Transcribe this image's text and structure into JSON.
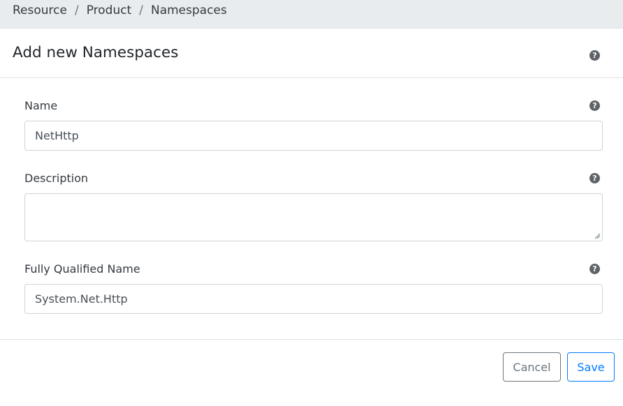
{
  "breadcrumb": {
    "items": [
      "Resource",
      "Product",
      "Namespaces"
    ],
    "separator": "/"
  },
  "card": {
    "title": "Add new Namespaces",
    "help_icon": "question-circle-icon"
  },
  "form": {
    "name": {
      "label": "Name",
      "value": "NetHttp"
    },
    "description": {
      "label": "Description",
      "value": ""
    },
    "fully_qualified_name": {
      "label": "Fully Qualified Name",
      "value": "System.Net.Http"
    }
  },
  "actions": {
    "cancel_label": "Cancel",
    "save_label": "Save"
  },
  "colors": {
    "primary": "#007bff",
    "secondary": "#6c757d",
    "breadcrumb_bg": "#e9ecef"
  }
}
